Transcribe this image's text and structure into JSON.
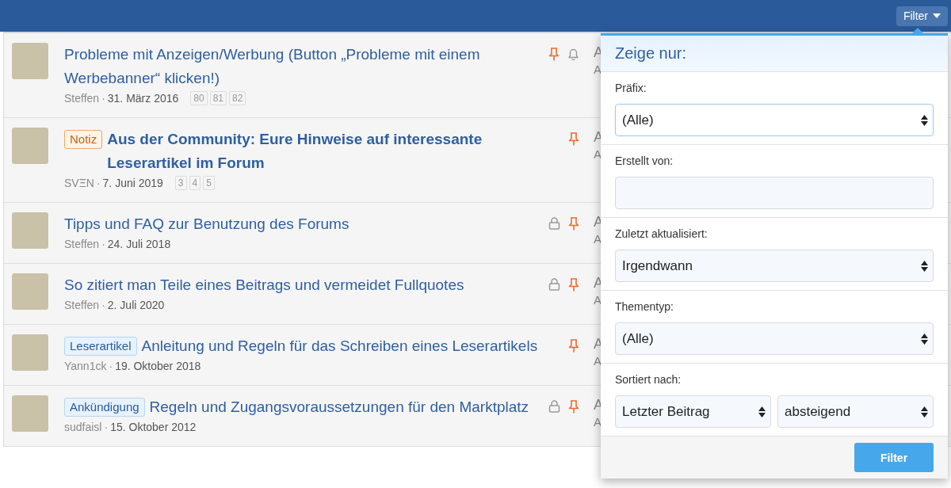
{
  "header": {
    "filter_button": "Filter"
  },
  "threads": [
    {
      "title": "Probleme mit Anzeigen/Werbung (Button „Probleme mit einem Werbebanner“ klicken!)",
      "unread": false,
      "author": "Steffen",
      "separator": "·",
      "date": "31. März 2016",
      "pages": [
        "80",
        "81",
        "82"
      ],
      "locked": false,
      "pinned": true,
      "watched": true,
      "column_3": "A",
      "column_4": "A"
    },
    {
      "prefix": {
        "label": "Notiz",
        "kind": "notice"
      },
      "title": "Aus der Community: Eure Hinweise auf interessante Leserartikel im Forum",
      "unread": true,
      "author": "SVΞN",
      "separator": "·",
      "date": "7. Juni 2019",
      "pages": [
        "3",
        "4",
        "5"
      ],
      "locked": false,
      "pinned": true,
      "watched": false,
      "column_3": "A",
      "column_4": "A"
    },
    {
      "title": "Tipps und FAQ zur Benutzung des Forums",
      "unread": false,
      "author": "Steffen",
      "separator": "·",
      "date": "24. Juli 2018",
      "locked": true,
      "pinned": true,
      "watched": false,
      "column_3": "A",
      "column_4": "A"
    },
    {
      "title": "So zitiert man Teile eines Beitrags und vermeidet Fullquotes",
      "unread": false,
      "author": "Steffen",
      "separator": "·",
      "date": "2. Juli 2020",
      "locked": true,
      "pinned": true,
      "watched": false,
      "column_3": "A",
      "column_4": "A"
    },
    {
      "prefix": {
        "label": "Leserartikel",
        "kind": "info"
      },
      "title": "Anleitung und Regeln für das Schreiben eines Leserartikels",
      "unread": false,
      "author": "Yann1ck",
      "separator": "·",
      "date": "19. Oktober 2018",
      "locked": false,
      "pinned": true,
      "watched": false,
      "column_3": "A",
      "column_4": "A"
    },
    {
      "prefix": {
        "label": "Ankündigung",
        "kind": "info"
      },
      "title": "Regeln und Zugangsvoraussetzungen für den Marktplatz",
      "unread": false,
      "author": "sudfaisl",
      "separator": "·",
      "date": "15. Oktober 2012",
      "locked": true,
      "pinned": true,
      "watched": false,
      "column_3": "A",
      "column_4": "A"
    }
  ],
  "filter_popup": {
    "title": "Zeige nur:",
    "fields": [
      {
        "label": "Präfix:",
        "controls": [
          {
            "kind": "select",
            "value": "(Alle)",
            "focused": true
          }
        ]
      },
      {
        "label": "Erstellt von:",
        "controls": [
          {
            "kind": "input",
            "focused": false
          }
        ]
      },
      {
        "label": "Zuletzt aktualisiert:",
        "controls": [
          {
            "kind": "select",
            "value": "Irgendwann",
            "focused": false
          }
        ]
      },
      {
        "label": "Thementyp:",
        "controls": [
          {
            "kind": "select",
            "value": "(Alle)",
            "focused": false
          }
        ]
      },
      {
        "label": "Sortiert nach:",
        "controls": [
          {
            "kind": "select",
            "value": "Letzter Beitrag",
            "focused": false
          },
          {
            "kind": "select",
            "value": "absteigend",
            "focused": false
          }
        ]
      }
    ],
    "submit_button": "Filter"
  }
}
